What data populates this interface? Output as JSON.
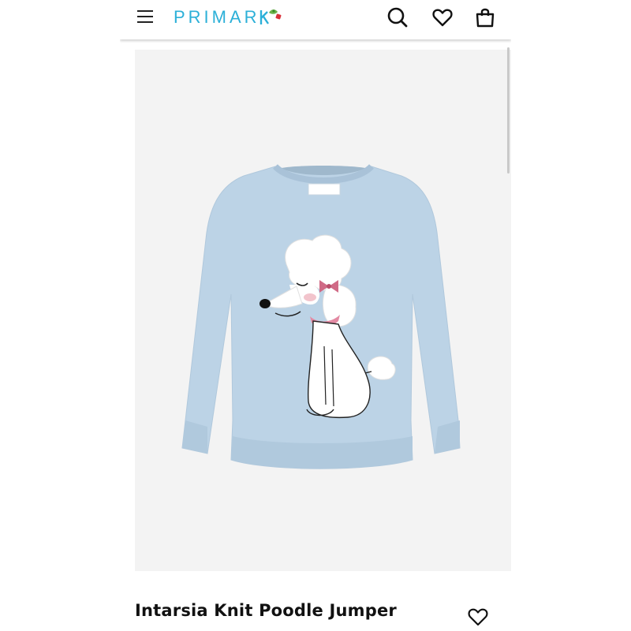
{
  "header": {
    "menu_icon": "hamburger-menu-icon",
    "logo_text": "PRIMAR",
    "search_icon": "search-icon",
    "wishlist_icon": "heart-icon",
    "bag_icon": "shopping-bag-icon"
  },
  "product": {
    "label_text": "PRIMARK",
    "title": "Intarsia Knit Poodle Jumper",
    "wishlist_icon": "heart-outline-icon"
  },
  "colors": {
    "brand": "#2cb0d8",
    "jumper": "#bcd3e6",
    "image_background": "#f3f3f3"
  }
}
